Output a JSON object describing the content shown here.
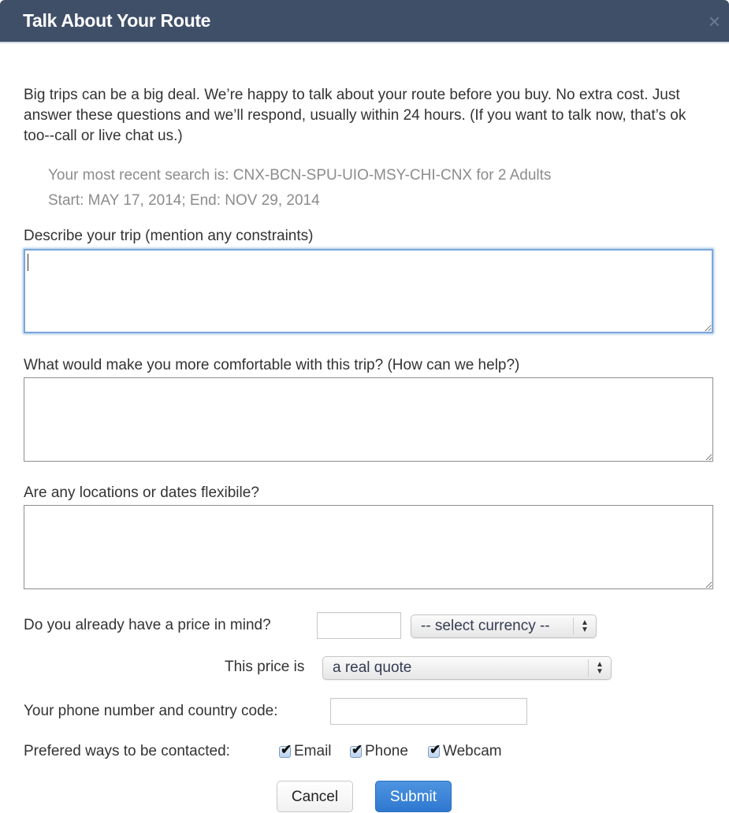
{
  "dialog": {
    "title": "Talk About Your Route",
    "close_icon": "×"
  },
  "intro": "Big trips can be a big deal. We’re happy to talk about your route before you buy. No extra cost. Just answer these questions and we’ll respond, usually within 24 hours. (If you want to talk now, that’s ok too--call or live chat us.)",
  "search_info": {
    "line1": "Your most recent search is: CNX-BCN-SPU-UIO-MSY-CHI-CNX for 2 Adults",
    "line2": "Start: MAY 17, 2014; End: NOV 29, 2014"
  },
  "fields": {
    "describe_label": "Describe your trip (mention any constraints)",
    "describe_value": "",
    "comfort_label": "What would make you more comfortable with this trip? (How can we help?)",
    "comfort_value": "",
    "flexible_label": "Are any locations or dates flexibile?",
    "flexible_value": "",
    "price_label": "Do you already have a price in mind?",
    "price_value": "",
    "currency_selected": "-- select currency --",
    "price_type_label": "This price is",
    "price_type_selected": "a real quote",
    "phone_label": "Your phone number and country code:",
    "phone_value": "",
    "contact_label": "Prefered ways to be contacted:",
    "contact_options": [
      {
        "label": "Email",
        "checked": true
      },
      {
        "label": "Phone",
        "checked": true
      },
      {
        "label": "Webcam",
        "checked": true
      }
    ]
  },
  "buttons": {
    "cancel": "Cancel",
    "submit": "Submit"
  },
  "colors": {
    "header_bg": "#3f4f68",
    "submit_bg": "#3480d6",
    "focus_ring": "#7aa7d9"
  }
}
